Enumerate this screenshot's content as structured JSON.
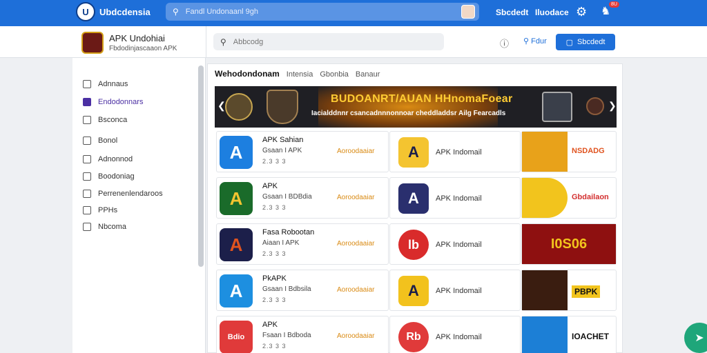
{
  "topbar": {
    "brand": "Ubdcdensia",
    "search_placeholder": "Fandl Undonaanl 9gh",
    "link1": "Sbcdedt",
    "link2": "Iluodace",
    "badge": "8U"
  },
  "subheader": {
    "app_title": "APK Undohiai",
    "app_subtitle": "Fbdodinjascaaon APK",
    "search_placeholder": "Abbcodg",
    "search_label": "Fdur",
    "primary_button": "Sbcdedt"
  },
  "sidebar": {
    "items": [
      {
        "label": "Adnnaus",
        "icon": "home-icon"
      },
      {
        "label": "Endodonnars",
        "icon": "apps-icon",
        "active": true
      },
      {
        "label": "Bsconca",
        "icon": "shield-icon"
      },
      {
        "label": "Bonol",
        "icon": "user-icon"
      },
      {
        "label": "Adnonnod",
        "icon": "folder-icon"
      },
      {
        "label": "Boodoniag",
        "icon": "doc-icon"
      },
      {
        "label": "Perrenenlendaroos",
        "icon": "list-icon"
      },
      {
        "label": "PPHs",
        "icon": "grid-icon"
      },
      {
        "label": "Nbcoma",
        "icon": "settings-icon"
      }
    ]
  },
  "tabs": {
    "main": "Wehodondonam",
    "t1": "Intensia",
    "t2": "Gbonbia",
    "t3": "Banaur"
  },
  "banner": {
    "title": "BUDOANRT/AUAN HHnomaFoear",
    "subtitle": "Iacialddnnr csancadnnnonnoar cheddladdsr Ailg Fearcadls"
  },
  "rows": [
    {
      "name": "APK Sahian",
      "sub": "Gsaan I APK",
      "ver": "2.3 3 3",
      "dl": "Aoroodaaiar",
      "icon_color": "#1d7fe0",
      "icon_glyph": "A",
      "c2_name": "APK Indomail",
      "c2_color": "#f4c430",
      "c2_glyph": "A",
      "c3_text": "NSDADG",
      "c3_color": "#e0531f"
    },
    {
      "name": "APK",
      "sub": "Gsaan I BDBdia",
      "ver": "2.3 3 3",
      "dl": "Aoroodaaiar",
      "icon_color": "#1a6b2a",
      "icon_glyph": "A",
      "c2_name": "APK Indomail",
      "c2_color": "#2a2f6e",
      "c2_glyph": "A",
      "c3_text": "Gbdailaon",
      "c3_color": "#d32f2f"
    },
    {
      "name": "Fasa Robootan",
      "sub": "Aiaan I APK",
      "ver": "2.3 3 3",
      "dl": "Aoroodaaiar",
      "icon_color": "#1c1f4a",
      "icon_glyph": "A",
      "c2_name": "APK Indomail",
      "c2_color": "#d92b2b",
      "c2_glyph": "lb",
      "c3_text": "I0S06",
      "c3_color": "#f2c41d"
    },
    {
      "name": "PkAPK",
      "sub": "Gsaan I Bdbsila",
      "ver": "2.3 3 3",
      "dl": "Aoroodaaiar",
      "icon_color": "#1d8fe0",
      "icon_glyph": "A",
      "c2_name": "APK Indomail",
      "c2_color": "#f2c21d",
      "c2_glyph": "A",
      "c3_text": "PBPK",
      "c3_color": "#f2c41d"
    },
    {
      "name": "APK",
      "sub": "Fsaan I Bdboda",
      "ver": "2.3 3 3",
      "dl": "Aoroodaaiar",
      "icon_color": "#e03a3a",
      "icon_glyph": "Bdio",
      "c2_name": "APK Indomail",
      "c2_color": "#e03a3a",
      "c2_glyph": "Rb",
      "c3_text": "IOACHET",
      "c3_color": "#111111"
    }
  ]
}
